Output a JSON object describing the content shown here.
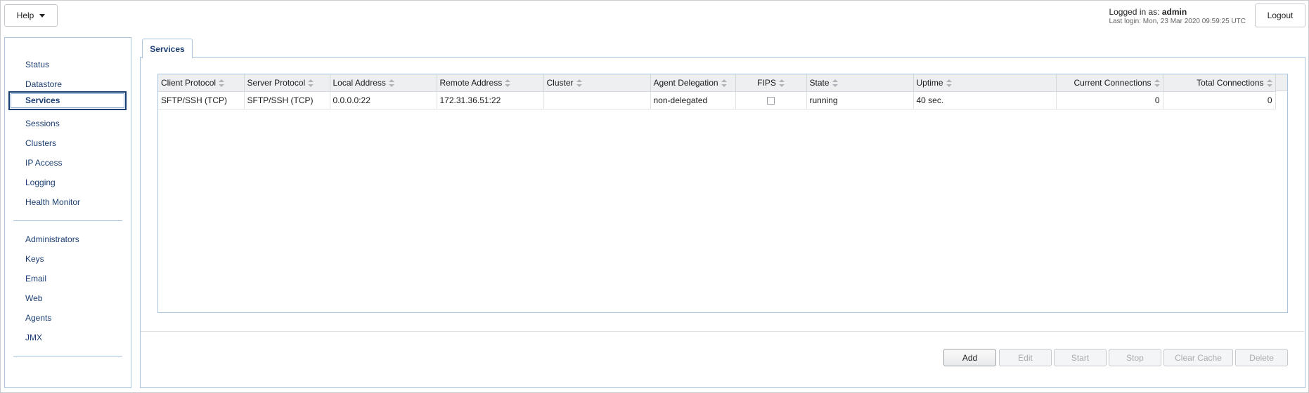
{
  "header": {
    "help_label": "Help",
    "logged_in_prefix": "Logged in as:",
    "username": "admin",
    "last_login": "Last login: Mon, 23 Mar 2020 09:59:25 UTC",
    "logout_label": "Logout"
  },
  "sidebar": {
    "group1": [
      "Status",
      "Datastore",
      "Services",
      "Sessions",
      "Clusters",
      "IP Access",
      "Logging",
      "Health Monitor"
    ],
    "group2": [
      "Administrators",
      "Keys",
      "Email",
      "Web",
      "Agents",
      "JMX"
    ],
    "active": "Services"
  },
  "main": {
    "tab_label": "Services",
    "columns": [
      "Client Protocol",
      "Server Protocol",
      "Local Address",
      "Remote Address",
      "Cluster",
      "Agent Delegation",
      "FIPS",
      "State",
      "Uptime",
      "Current Connections",
      "Total Connections"
    ],
    "rows": [
      {
        "client_protocol": "SFTP/SSH (TCP)",
        "server_protocol": "SFTP/SSH (TCP)",
        "local_address": "0.0.0.0:22",
        "remote_address": "172.31.36.51:22",
        "cluster": "",
        "agent_delegation": "non-delegated",
        "fips": false,
        "state": "running",
        "uptime": "40 sec.",
        "current_connections": "0",
        "total_connections": "0"
      }
    ],
    "buttons": {
      "add": "Add",
      "edit": "Edit",
      "start": "Start",
      "stop": "Stop",
      "clear_cache": "Clear Cache",
      "delete": "Delete"
    }
  },
  "colors": {
    "nav_text": "#1c3f73",
    "panel_border": "#a9c4e0",
    "header_bg": "#eeeff1"
  }
}
